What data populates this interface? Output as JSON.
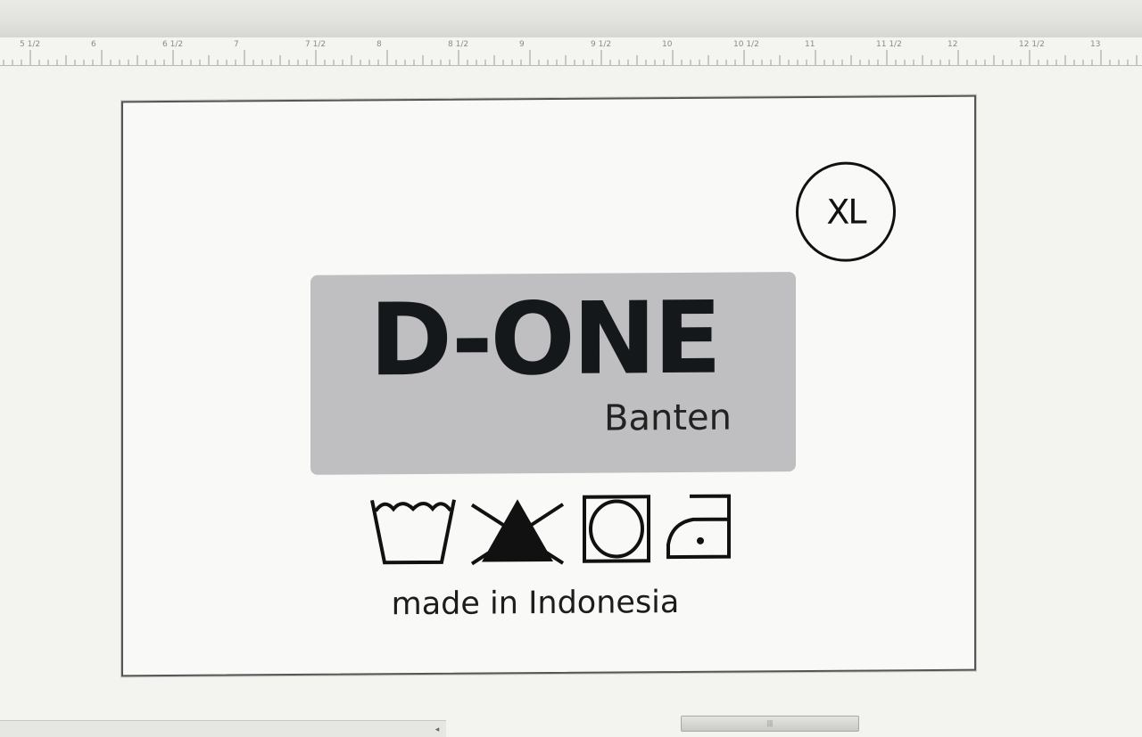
{
  "ruler": {
    "labels": [
      "5 1/2",
      "6",
      "6 1/2",
      "7",
      "7 1/2",
      "8",
      "8 1/2",
      "9",
      "9 1/2",
      "10",
      "10 1/2",
      "11",
      "11 1/2",
      "12",
      "12 1/2",
      "13"
    ]
  },
  "label_design": {
    "size": "XL",
    "brand": "D-ONE",
    "region": "Banten",
    "care_icons": [
      "wash-tub-icon",
      "no-bleach-icon",
      "tumble-dry-icon",
      "iron-low-icon"
    ],
    "footer": "made in Indonesia"
  },
  "scrollbar": {
    "left_arrow": "◂",
    "thumb_grip": "|||"
  },
  "colors": {
    "brand_box": "#bfbec1",
    "ink": "#15181b",
    "page": "#f9f9f7"
  }
}
